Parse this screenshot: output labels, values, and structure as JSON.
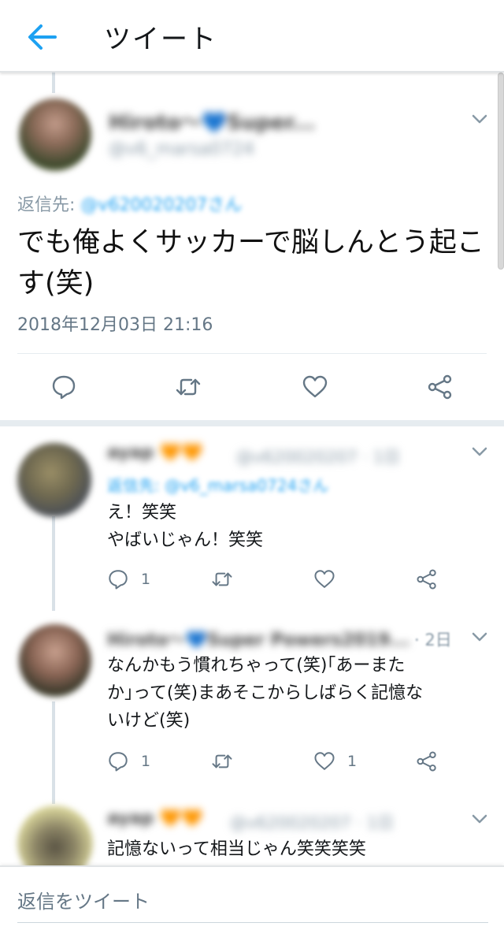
{
  "header": {
    "title": "ツイート"
  },
  "main_tweet": {
    "name": "Hiroto〜💙Super...",
    "handle": "@v6_marsa0724",
    "reply_label": "返信先:",
    "reply_user": "@v620020207さん",
    "text": "でも俺よくサッカーで脳しんとう起こす(笑)",
    "timestamp": "2018年12月03日 21:16"
  },
  "replies": [
    {
      "name": "ayap 🧡🧡",
      "meta": "@v620020207 · 1日",
      "reply_to": "返信先: @v6_marsa0724さん",
      "text_lines": [
        "え！笑笑",
        "やばいじゃん！笑笑"
      ],
      "reply_count": "1",
      "like_count": ""
    },
    {
      "name": "Hiroto〜💙Super Powers2019...",
      "meta": "· 2日",
      "reply_to": "",
      "text_lines": [
        "なんかもう慣れちゃって(笑)｢あーまた",
        "か｣って(笑)まあそこからしばらく記憶な",
        "いけど(笑)"
      ],
      "reply_count": "1",
      "like_count": "1"
    },
    {
      "name": "ayap 🧡🧡",
      "meta": "@v620020207 · 1日",
      "reply_to": "",
      "text_lines": [
        "記憶ないって相当じゃん笑笑笑笑"
      ],
      "reply_count": "",
      "like_count": ""
    }
  ],
  "footer": {
    "reply_placeholder": "返信をツイート"
  },
  "colors": {
    "accent": "#1da1f2",
    "text": "#14171a",
    "secondary": "#657786",
    "icon": "#657786",
    "divider": "#e6ecf0"
  },
  "icons": [
    "back-arrow-icon",
    "chevron-down-icon",
    "reply-icon",
    "retweet-icon",
    "like-icon",
    "share-icon"
  ]
}
